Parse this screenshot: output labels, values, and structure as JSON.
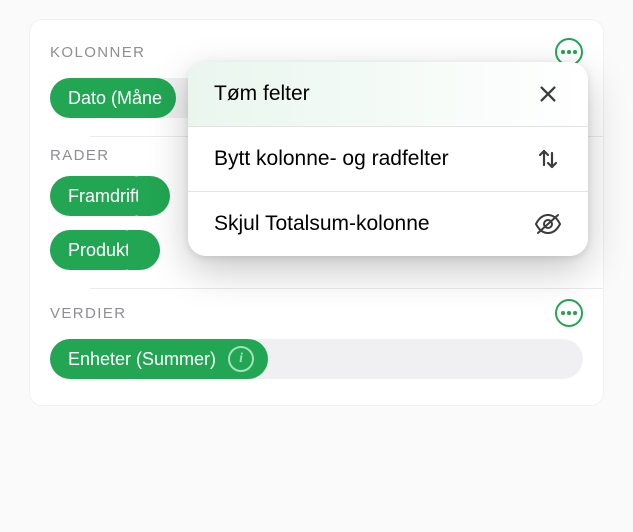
{
  "sections": {
    "columns": {
      "title": "KOLONNER",
      "chips": [
        "Dato (Måne"
      ]
    },
    "rows": {
      "title": "RADER",
      "chips": [
        "Framdrift",
        "Produkt"
      ]
    },
    "values": {
      "title": "VERDIER",
      "chips": [
        "Enheter (Summer)"
      ]
    }
  },
  "popup": {
    "items": [
      "Tøm felter",
      "Bytt kolonne- og radfelter",
      "Skjul Totalsum-kolonne"
    ]
  }
}
